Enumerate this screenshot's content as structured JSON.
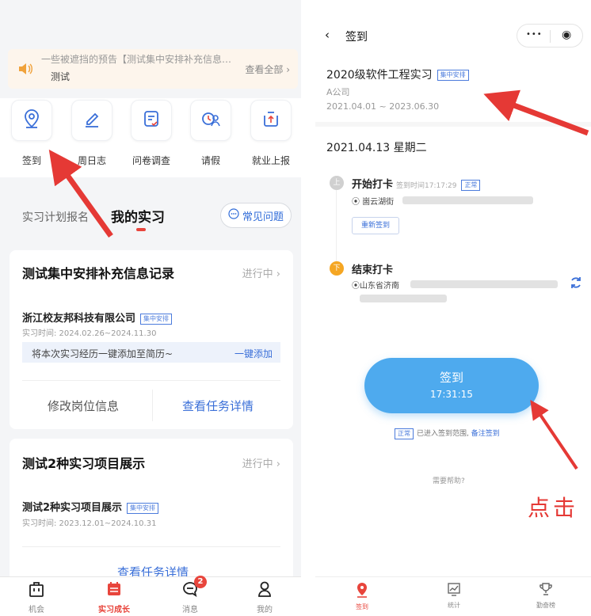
{
  "left": {
    "notice": {
      "line1": "一些被遮挡的预告【测试集中安排补充信息…",
      "line2": "测试",
      "more": "查看全部 ›"
    },
    "quick_actions": [
      {
        "label": "签到",
        "icon": "location-pin-icon"
      },
      {
        "label": "周日志",
        "icon": "edit-pen-icon"
      },
      {
        "label": "问卷调查",
        "icon": "survey-icon"
      },
      {
        "label": "请假",
        "icon": "leave-icon"
      },
      {
        "label": "就业上报",
        "icon": "upload-report-icon"
      }
    ],
    "tabs": {
      "plan": "实习计划报名",
      "mine": "我的实习",
      "faq": "常见问题"
    },
    "cards": [
      {
        "title": "测试集中安排补充信息记录",
        "status": "进行中 ›",
        "company": "浙江校友邦科技有限公司",
        "badge": "集中安排",
        "period": "实习时间: 2024.02.26~2024.11.30",
        "add_text": "将本次实习经历一键添加至简历~",
        "add_action": "一键添加",
        "action_left": "修改岗位信息",
        "action_right": "查看任务详情"
      },
      {
        "title": "测试2种实习项目展示",
        "status": "进行中 ›",
        "company": "测试2种实习项目展示",
        "badge": "集中安排",
        "period": "实习时间: 2023.12.01~2024.10.31",
        "action_center": "查看任务详情"
      }
    ],
    "tabbar": [
      {
        "label": "机会",
        "icon": "briefcase-icon"
      },
      {
        "label": "实习成长",
        "icon": "calendar-icon"
      },
      {
        "label": "消息",
        "icon": "chat-bubble-icon",
        "badge": "2"
      },
      {
        "label": "我的",
        "icon": "person-icon"
      }
    ]
  },
  "right": {
    "nav": {
      "back": "‹",
      "title": "签到",
      "more": "•••",
      "close": "◉"
    },
    "project": {
      "name": "2020级软件工程实习",
      "badge": "集中安排",
      "company": "A公司",
      "dates": "2021.04.01 ~ 2023.06.30"
    },
    "date": "2021.04.13 星期二",
    "start": {
      "marker": "上",
      "title": "开始打卡",
      "time": "签到时间17:17:29",
      "tag": "正常",
      "location": "崮云湖街",
      "resign": "重新签到"
    },
    "end": {
      "marker": "下",
      "title": "结束打卡",
      "location": "山东省济南"
    },
    "signin": {
      "label": "签到",
      "time": "17:31:15"
    },
    "range": {
      "tag": "正常",
      "text": "已进入签到范围,",
      "link": "备注签到"
    },
    "help": "需要帮助?",
    "annotation": "点击",
    "tabbar": [
      {
        "label": "签到",
        "icon": "location-pin-icon"
      },
      {
        "label": "统计",
        "icon": "chart-icon"
      },
      {
        "label": "勤奋榜",
        "icon": "trophy-icon"
      }
    ]
  },
  "colors": {
    "accent_red": "#e8453c",
    "link_blue": "#3a6fd8",
    "button_blue": "#4eaaee",
    "arrow_red": "#e53935"
  }
}
